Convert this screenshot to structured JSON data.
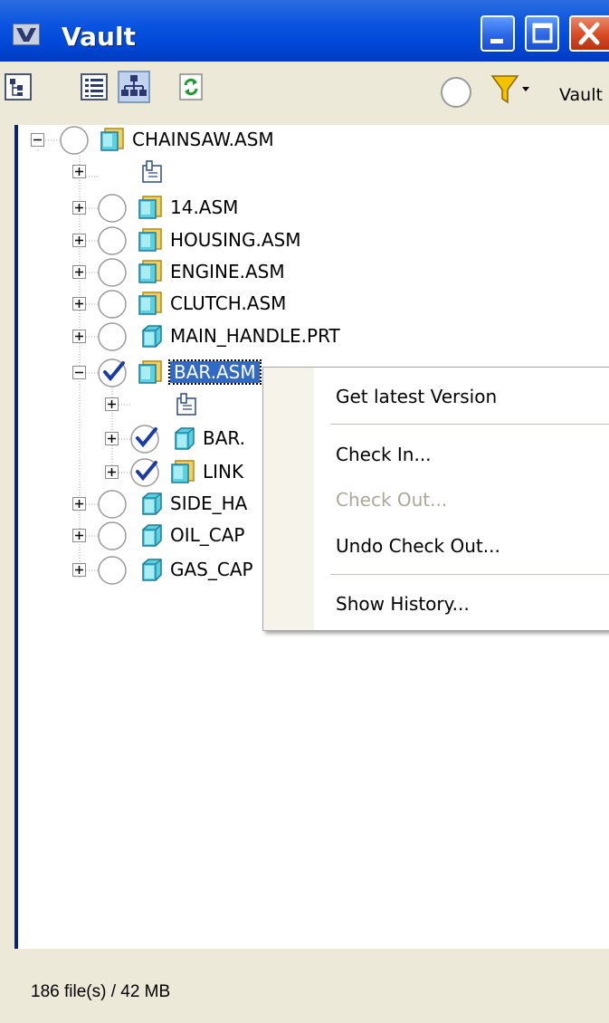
{
  "window": {
    "title": "Vault"
  },
  "toolbar": {
    "filter_label": "Vault",
    "tools": [
      "tree-view-icon",
      "list-view-icon",
      "hierarchy-view-icon",
      "refresh-icon"
    ],
    "pressed_tool": "hierarchy-view-icon"
  },
  "tree": {
    "items": [
      {
        "label": "CHAINSAW.ASM",
        "type": "assembly",
        "status": "none",
        "expanded": true
      },
      {
        "label": "",
        "type": "drawing",
        "status": "",
        "expanded": false
      },
      {
        "label": "14.ASM",
        "type": "assembly",
        "status": "none",
        "expanded": false
      },
      {
        "label": "HOUSING.ASM",
        "type": "assembly",
        "status": "none",
        "expanded": false
      },
      {
        "label": "ENGINE.ASM",
        "type": "assembly",
        "status": "none",
        "expanded": false
      },
      {
        "label": "CLUTCH.ASM",
        "type": "assembly",
        "status": "none",
        "expanded": false
      },
      {
        "label": "MAIN_HANDLE.PRT",
        "type": "part",
        "status": "none",
        "expanded": false
      },
      {
        "label": "BAR.ASM",
        "type": "assembly",
        "status": "checked-out",
        "expanded": true,
        "selected": true
      },
      {
        "label": "",
        "type": "drawing",
        "status": "",
        "expanded": false
      },
      {
        "label": "BAR.",
        "type": "part",
        "status": "checked-out",
        "expanded": false
      },
      {
        "label": "LINK",
        "type": "assembly",
        "status": "checked-out",
        "expanded": false
      },
      {
        "label": "SIDE_HA",
        "type": "part",
        "status": "none",
        "expanded": false
      },
      {
        "label": "OIL_CAP",
        "type": "part",
        "status": "none",
        "expanded": false
      },
      {
        "label": "GAS_CAP",
        "type": "part",
        "status": "none",
        "expanded": false
      }
    ]
  },
  "context_menu": {
    "get_latest": "Get latest Version",
    "check_in": "Check In...",
    "check_out": "Check Out...",
    "undo_check_out": "Undo Check Out...",
    "show_history": "Show History..."
  },
  "status_bar": {
    "text": "186  file(s) /  42 MB"
  },
  "colors": {
    "title_bar": "#0a54e0",
    "selection": "#316ac5",
    "face": "#ece9d8",
    "check": "#1a3aa8"
  }
}
